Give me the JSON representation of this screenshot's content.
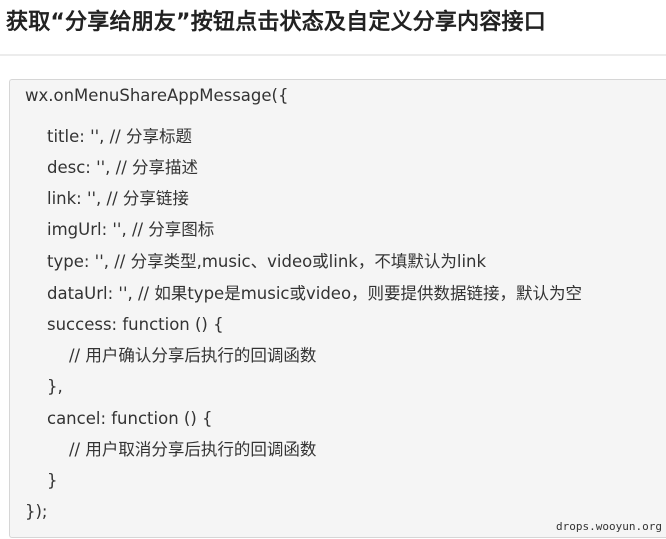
{
  "heading": "获取“分享给朋友”按钮点击状态及自定义分享内容接口",
  "code_lines": [
    "wx.onMenuShareAppMessage({",
    "title: '', // 分享标题",
    "desc: '', // 分享描述",
    "link: '', // 分享链接",
    "imgUrl: '', // 分享图标",
    "type: '', // 分享类型,music、video或link，不填默认为link",
    "dataUrl: '', // 如果type是music或video，则要提供数据链接，默认为空",
    "success: function () {",
    "// 用户确认分享后执行的回调函数",
    "},",
    "cancel: function () {",
    "// 用户取消分享后执行的回调函数",
    "}",
    "});"
  ],
  "watermark": "drops.wooyun.org"
}
